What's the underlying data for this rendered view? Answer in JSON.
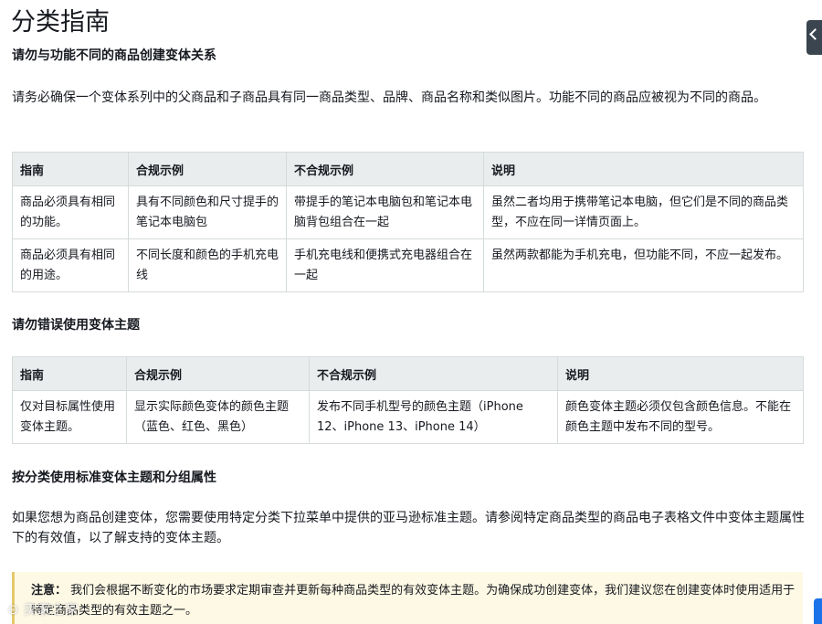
{
  "page": {
    "title": "分类指南"
  },
  "section1": {
    "heading": "请勿与功能不同的商品创建变体关系",
    "intro": "请务必确保一个变体系列中的父商品和子商品具有同一商品类型、品牌、商品名称和类似图片。功能不同的商品应被视为不同的商品。",
    "table": {
      "headers": [
        "指南",
        "合规示例",
        "不合规示例",
        "说明"
      ],
      "rows": [
        [
          "商品必须具有相同的功能。",
          "具有不同颜色和尺寸提手的笔记本电脑包",
          "带提手的笔记本电脑包和笔记本电脑背包组合在一起",
          "虽然二者均用于携带笔记本电脑，但它们是不同的商品类型，不应在同一详情页面上。"
        ],
        [
          "商品必须具有相同的用途。",
          "不同长度和颜色的手机充电线",
          "手机充电线和便携式充电器组合在一起",
          "虽然两款都能为手机充电，但功能不同，不应一起发布。"
        ]
      ]
    }
  },
  "section2": {
    "heading": "请勿错误使用变体主题",
    "table": {
      "headers": [
        "指南",
        "合规示例",
        "不合规示例",
        "说明"
      ],
      "rows": [
        [
          "仅对目标属性使用变体主题。",
          "显示实际颜色变体的颜色主题（蓝色、红色、黑色）",
          "发布不同手机型号的颜色主题（iPhone 12、iPhone 13、iPhone 14）",
          "颜色变体主题必须仅包含颜色信息。不能在颜色主题中发布不同的型号。"
        ]
      ]
    }
  },
  "section3": {
    "heading": "按分类使用标准变体主题和分组属性",
    "body": "如果您想为商品创建变体，您需要使用特定分类下拉菜单中提供的亚马逊标准主题。请参阅特定商品类型的商品电子表格文件中变体主题属性下的有效值，以了解支持的变体主题。"
  },
  "note": {
    "label": "注意：",
    "text": "我们会根据不断变化的市场要求定期审查并更新每种商品类型的有效变体主题。为确保成功创建变体，我们建议您在创建变体时使用适用于特定商品类型的有效主题之一。"
  },
  "watermark": {
    "text": "⊙ 卖家之家"
  },
  "colors": {
    "header_bg": "#eaeded",
    "border": "#d5dbdb",
    "note_bg": "#fef9e4",
    "side_tab": "#3b4550",
    "accent_blue": "#1a73e8"
  },
  "icons": {
    "side_tab": "chevron-left-icon"
  }
}
